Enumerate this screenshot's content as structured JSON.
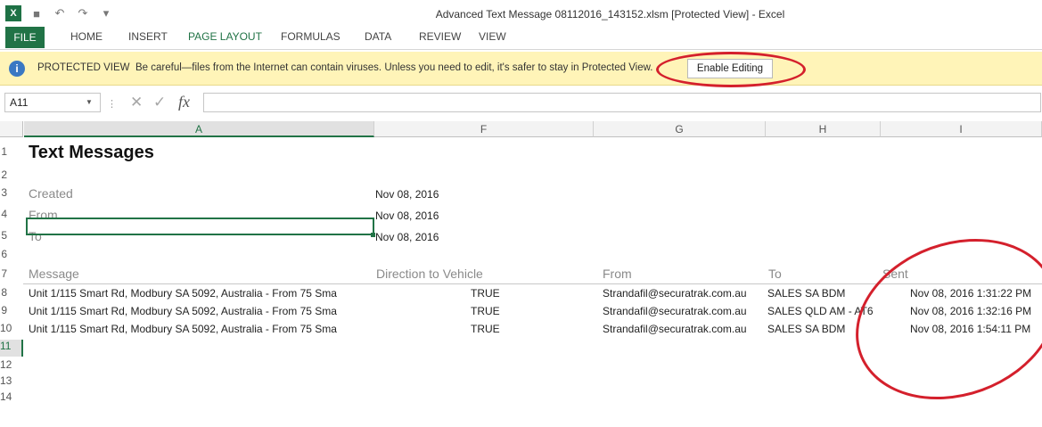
{
  "window": {
    "title": "Advanced Text Message 08112016_143152.xlsm  [Protected View] - Excel",
    "logo": "X"
  },
  "ribbon": {
    "tabs": [
      "FILE",
      "HOME",
      "INSERT",
      "PAGE LAYOUT",
      "FORMULAS",
      "DATA",
      "REVIEW",
      "VIEW"
    ]
  },
  "protected_view": {
    "label": "PROTECTED VIEW",
    "message": "Be careful—files from the Internet can contain viruses. Unless you need to edit, it's safer to stay in Protected View.",
    "button": "Enable Editing",
    "icon": "info-shield-icon",
    "annotation_color": "#d4202c"
  },
  "formula_bar": {
    "name_box": "A11",
    "fx": "fx",
    "value": ""
  },
  "grid": {
    "columns": [
      "A",
      "F",
      "G",
      "H",
      "I"
    ],
    "rows": [
      "1",
      "2",
      "3",
      "4",
      "5",
      "6",
      "7",
      "8",
      "9",
      "10",
      "11",
      "12",
      "13",
      "14"
    ],
    "title": "Text Messages",
    "meta": [
      {
        "label": "Created",
        "value": "Nov 08, 2016"
      },
      {
        "label": "From",
        "value": "Nov 08, 2016"
      },
      {
        "label": "To",
        "value": "Nov 08, 2016"
      }
    ],
    "headers": [
      "Message",
      "Direction to Vehicle",
      "From",
      "To",
      "Sent"
    ],
    "data": [
      {
        "message": "Unit 1/115 Smart Rd, Modbury SA 5092, Australia - From 75 Sma",
        "direction": "TRUE",
        "from": "Strandafil@securatrak.com.au",
        "to": "SALES SA BDM",
        "sent": "Nov 08, 2016 1:31:22 PM"
      },
      {
        "message": "Unit 1/115 Smart Rd, Modbury SA 5092, Australia - From 75 Sma",
        "direction": "TRUE",
        "from": "Strandafil@securatrak.com.au",
        "to": "SALES QLD AM - AT6",
        "sent": "Nov 08, 2016 1:32:16 PM"
      },
      {
        "message": "Unit 1/115 Smart Rd, Modbury SA 5092, Australia - From 75 Sma",
        "direction": "TRUE",
        "from": "Strandafil@securatrak.com.au",
        "to": "SALES SA BDM",
        "sent": "Nov 08, 2016 1:54:11 PM"
      }
    ],
    "accent": "#217346"
  }
}
